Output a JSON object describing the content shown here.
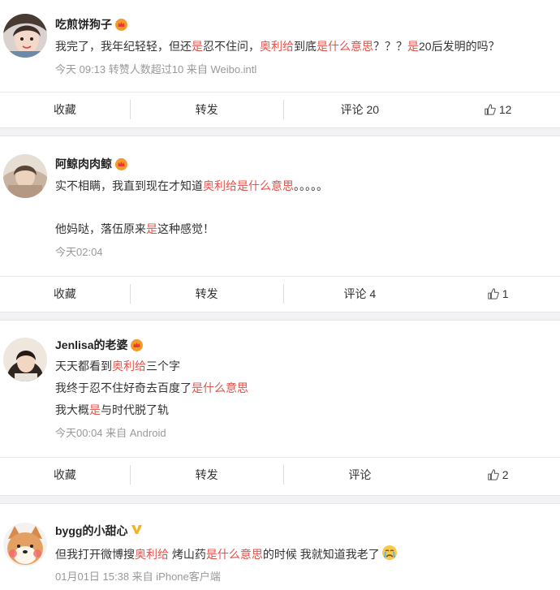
{
  "colors": {
    "highlight": "#e0534b",
    "meta": "#999999",
    "divider": "#f2f2f5",
    "crown": "#f39a2b",
    "vip": "#f5b41c"
  },
  "posts": [
    {
      "user": "吃煎饼狗子",
      "badge_icon": "crown-badge-icon",
      "lines": [
        [
          {
            "t": "我完了，我年纪轻轻，但还"
          },
          {
            "t": "是",
            "h": true
          },
          {
            "t": "忍不住问，"
          },
          {
            "t": "奥利给",
            "h": true
          },
          {
            "t": "到底"
          },
          {
            "t": "是什么意思",
            "h": true
          },
          {
            "t": "？？？"
          },
          {
            "t": "是",
            "h": true
          },
          {
            "t": "20后发明的吗？"
          }
        ]
      ],
      "meta": "今天 09:13 转赞人数超过10  来自 Weibo.intl",
      "actions": {
        "collect": "收藏",
        "forward": "转发",
        "comment": "评论 20",
        "likes": "12"
      }
    },
    {
      "user": "阿鲸肉肉鲸",
      "badge_icon": "crown-badge-icon",
      "lines": [
        [
          {
            "t": "实不相瞒，我直到现在才知道"
          },
          {
            "t": "奥利给是什么意思",
            "h": true
          },
          {
            "t": "。。。。。"
          }
        ],
        [
          {
            "t": "他妈哒，落伍原来"
          },
          {
            "t": "是",
            "h": true
          },
          {
            "t": "这种感觉！"
          }
        ]
      ],
      "meta": "今天02:04",
      "actions": {
        "collect": "收藏",
        "forward": "转发",
        "comment": "评论 4",
        "likes": "1"
      }
    },
    {
      "user": "Jenlisa的老婆",
      "badge_icon": "crown-badge-icon",
      "lines": [
        [
          {
            "t": "天天都看到"
          },
          {
            "t": "奥利给",
            "h": true
          },
          {
            "t": "三个字"
          }
        ],
        [
          {
            "t": "我终于忍不住好奇去百度了"
          },
          {
            "t": "是什么意思",
            "h": true
          }
        ],
        [
          {
            "t": "我大概"
          },
          {
            "t": "是",
            "h": true
          },
          {
            "t": "与时代脱了轨"
          }
        ]
      ],
      "meta": "今天00:04  来自 Android",
      "actions": {
        "collect": "收藏",
        "forward": "转发",
        "comment": "评论",
        "likes": "2"
      }
    },
    {
      "user": "bygg的小甜心",
      "badge_icon": "vip-v-icon",
      "lines": [
        [
          {
            "t": "但我打开微博搜"
          },
          {
            "t": "奥利给",
            "h": true
          },
          {
            "t": " 烤山药"
          },
          {
            "t": "是什么意思",
            "h": true
          },
          {
            "t": "的时候 我就知道我老了"
          }
        ]
      ],
      "emoji_icon": "cry-face-emoji-icon",
      "meta": "01月01日 15:38  来自 iPhone客户端"
    }
  ]
}
